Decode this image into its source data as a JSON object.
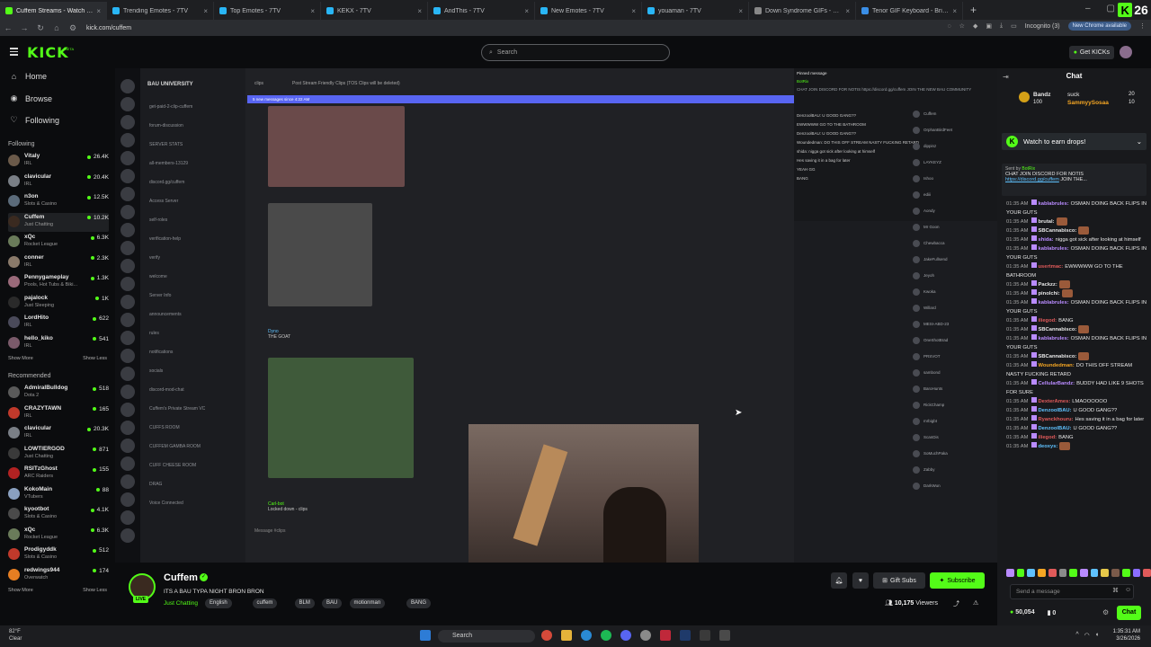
{
  "browser": {
    "tabs": [
      {
        "title": "Cuffem Streams - Watch Live on",
        "active": true,
        "color": "#53fc18"
      },
      {
        "title": "Trending Emotes - 7TV",
        "active": false,
        "color": "#29b6f6"
      },
      {
        "title": "Top Emotes - 7TV",
        "active": false,
        "color": "#29b6f6"
      },
      {
        "title": "KEKX - 7TV",
        "active": false,
        "color": "#29b6f6"
      },
      {
        "title": "AndThis - 7TV",
        "active": false,
        "color": "#29b6f6"
      },
      {
        "title": "New Emotes - 7TV",
        "active": false,
        "color": "#29b6f6"
      },
      {
        "title": "youaman - 7TV",
        "active": false,
        "color": "#29b6f6"
      },
      {
        "title": "Down Syndrome GIFs - Find &",
        "active": false,
        "color": "#888888"
      },
      {
        "title": "Tenor GIF Keyboard - Bring Pe",
        "active": false,
        "color": "#3a8ee6"
      }
    ],
    "new_tab": "+",
    "url": "kick.com/cuffem",
    "incognito_label": "Incognito (3)",
    "new_chrome_label": "New Chrome available",
    "kick_badge_letter": "K",
    "kick_badge_count": "26"
  },
  "header": {
    "logo": "KICK",
    "logo_beta": "BETA",
    "search_placeholder": "Search",
    "get_kicks_label": "Get KICKs"
  },
  "sidebar": {
    "nav": [
      {
        "label": "Home",
        "icon": "⌂"
      },
      {
        "label": "Browse",
        "icon": "◉"
      },
      {
        "label": "Following",
        "icon": "♡"
      }
    ],
    "following_title": "Following",
    "following": [
      {
        "name": "Vitaly",
        "category": "IRL",
        "viewers": "26.4K",
        "color": "#6b5a4a"
      },
      {
        "name": "clavicular",
        "category": "IRL",
        "viewers": "20.4K",
        "color": "#7a7f86"
      },
      {
        "name": "n3on",
        "category": "Slots & Casino",
        "viewers": "12.5K",
        "color": "#5b6b7a"
      },
      {
        "name": "Cuffem",
        "category": "Just Chatting",
        "viewers": "10.2K",
        "color": "#3a2a20",
        "selected": true
      },
      {
        "name": "xQc",
        "category": "Rocket League",
        "viewers": "6.3K",
        "color": "#6a7b5a"
      },
      {
        "name": "conner",
        "category": "IRL",
        "viewers": "2.3K",
        "color": "#8a7a6a"
      },
      {
        "name": "Pennygameplay",
        "category": "Pools, Hot Tubs & Biki...",
        "viewers": "1.3K",
        "color": "#9a6a7a"
      },
      {
        "name": "pajalock",
        "category": "Just Sleeping",
        "viewers": "1K",
        "color": "#2a2a2a"
      },
      {
        "name": "LordHito",
        "category": "IRL",
        "viewers": "622",
        "color": "#4a4a5a"
      },
      {
        "name": "hello_kiko",
        "category": "IRL",
        "viewers": "541",
        "color": "#7a5a6a"
      }
    ],
    "show_more": "Show More",
    "show_less": "Show Less",
    "recommended_title": "Recommended",
    "recommended": [
      {
        "name": "AdmiralBulldog",
        "category": "Dota 2",
        "viewers": "518",
        "color": "#5a5a5a"
      },
      {
        "name": "CRAZYTAWN",
        "category": "IRL",
        "viewers": "165",
        "color": "#c0392b"
      },
      {
        "name": "clavicular",
        "category": "IRL",
        "viewers": "20.3K",
        "color": "#7a7f86"
      },
      {
        "name": "LOWTIERGOD",
        "category": "Just Chatting",
        "viewers": "871",
        "color": "#3a3a3a"
      },
      {
        "name": "RSITzGhost",
        "category": "ARC Raiders",
        "viewers": "155",
        "color": "#b22222"
      },
      {
        "name": "KokoMain",
        "category": "VTubers",
        "viewers": "88",
        "color": "#8aa0c0"
      },
      {
        "name": "kyootbot",
        "category": "Slots & Casino",
        "viewers": "4.1K",
        "color": "#4a4a4a"
      },
      {
        "name": "xQc",
        "category": "Rocket League",
        "viewers": "6.3K",
        "color": "#6a7b5a"
      },
      {
        "name": "Prodigyddk",
        "category": "Slots & Casino",
        "viewers": "512",
        "color": "#c0392b"
      },
      {
        "name": "redwings944",
        "category": "Overwatch",
        "viewers": "174",
        "color": "#e67e22"
      }
    ]
  },
  "video": {
    "discord_server": "BAU UNIVERSITY",
    "channels": [
      "get-paid-2-clip-cuffem",
      "forum-discussion",
      "SERVER STATS",
      "all-members-13129",
      "discord.gg/cuffem",
      "Access Server",
      "self-roles",
      "verification-help",
      "verify",
      "welcome",
      "Server Info",
      "announcements",
      "rules",
      "notifications",
      "socials",
      "discord-mod-chat",
      "Cuffem's Private Stream VC",
      "CUFFS ROOM",
      "CUFFEM GAMBA ROOM",
      "CUFF CHEESE ROOM",
      "DRAG",
      "Voice Connected"
    ],
    "channel_header": "clips",
    "channel_topic": "Post Stream Friendly Clips (TOS Clips will be deleted)",
    "new_messages": "5 new messages since 4:22 AM",
    "messages": [
      {
        "user": "Dyno",
        "text": "THE GOAT"
      },
      {
        "user": "Carl-bot",
        "text": "Locked down - clips"
      }
    ],
    "message_placeholder": "Message #clips",
    "pinned_title": "Pinned message",
    "pinned_user": "BotRix",
    "pinned_text": "CHAT JOIN DISCORD FOR NOTIS https://discord.gg/cuffem JOIN THE NEW BAU COMMUNITY",
    "overlay_chat": [
      "DenzoolBAU: U GOOD GANG??",
      "EWWWWW GO TO THE BATHROOM",
      "DenzoolBAU: U GOOD GANG??",
      "Woundedman: DO THIS OFF STREAM NASTY FUCKING RETARD",
      "shida: nigga got sick after looking at himself",
      "Hes saving it in a bag for later",
      "YEAH GG",
      "BANG"
    ],
    "members": [
      "Cuffem",
      "OrphanBirdFeet",
      "dippinz",
      "LAYKEYZ",
      "Ishoo",
      "ediii",
      "Aondy",
      "Mr Goon",
      "Chewbacca",
      "JakeFullsend",
      "Jeyoh",
      "Kwoka",
      "Willard",
      "MESI-ABD-23",
      "OneShotBrad",
      "PRSVOT",
      "sambond",
      "BaroHunts",
      "RickChamp",
      "mrbigbt",
      "ScanDis",
      "SoMuchPaka",
      "Zabby",
      "DarkWun"
    ]
  },
  "stream": {
    "streamer": "Cuffem",
    "live_label": "LIVE",
    "title": "ITS A BAU TYPA NIGHT BRON BRON",
    "category": "Just Chatting",
    "tags": [
      "English",
      "cuffem",
      "BLM",
      "BAU",
      "motionman",
      "BANG"
    ],
    "gift_subs_label": "Gift Subs",
    "subscribe_label": "Subscribe",
    "viewers": "10,175",
    "viewers_label": "Viewers"
  },
  "chat": {
    "title": "Chat",
    "leaderboard": [
      {
        "name": "Bandz",
        "amount": "100",
        "value": "suck",
        "count": "20"
      },
      {
        "name": "SammyySosaa",
        "count": "10"
      }
    ],
    "watch_label": "Watch to earn drops!",
    "pinned_sent_by": "Sent by",
    "pinned_sender": "BotRix",
    "pinned_text": "CHAT JOIN DISCORD FOR NOTIS",
    "pinned_link": "https://discord.gg/cuffem",
    "pinned_more": "JOIN THE...",
    "messages": [
      {
        "time": "01:35 AM",
        "user": "kablabrules:",
        "color": "#b98bff",
        "text": "OSMAN DOING BACK FLIPS IN YOUR GUTS"
      },
      {
        "time": "01:35 AM",
        "user": "brutal:",
        "color": "#e6e6e6",
        "text": ""
      },
      {
        "time": "01:35 AM",
        "user": "SBCannabisco:",
        "color": "#e6e6e6",
        "text": ""
      },
      {
        "time": "01:35 AM",
        "user": "shida:",
        "color": "#b98bff",
        "text": "nigga got sick after looking at himself"
      },
      {
        "time": "01:35 AM",
        "user": "kablabrules:",
        "color": "#b98bff",
        "text": "OSMAN DOING BACK FLIPS IN YOUR GUTS"
      },
      {
        "time": "01:35 AM",
        "user": "usertmac:",
        "color": "#e05a5a",
        "text": "EWWWWW GO TO THE BATHROOM"
      },
      {
        "time": "01:35 AM",
        "user": "Packzz:",
        "color": "#e6e6e6",
        "text": ""
      },
      {
        "time": "01:35 AM",
        "user": "pinolchi:",
        "color": "#e6e6e6",
        "text": ""
      },
      {
        "time": "01:35 AM",
        "user": "kablabrules:",
        "color": "#b98bff",
        "text": "OSMAN DOING BACK FLIPS IN YOUR GUTS"
      },
      {
        "time": "01:35 AM",
        "user": "iliegod:",
        "color": "#e05a5a",
        "text": "BANG"
      },
      {
        "time": "01:35 AM",
        "user": "SBCannabisco:",
        "color": "#e6e6e6",
        "text": ""
      },
      {
        "time": "01:35 AM",
        "user": "kablabrules:",
        "color": "#b98bff",
        "text": "OSMAN DOING BACK FLIPS IN YOUR GUTS"
      },
      {
        "time": "01:35 AM",
        "user": "SBCannabisco:",
        "color": "#e6e6e6",
        "text": ""
      },
      {
        "time": "01:35 AM",
        "user": "Woundedman:",
        "color": "#f5a623",
        "text": "DO THIS OFF STREAM NASTY FUCKING RETARD"
      },
      {
        "time": "01:35 AM",
        "user": "CellularBandz:",
        "color": "#b98bff",
        "text": "BUDDY HAD LIKE 9 SHOTS FOR SURE"
      },
      {
        "time": "01:35 AM",
        "user": "DexterAmes:",
        "color": "#e05a5a",
        "text": "LMAOOOOOO"
      },
      {
        "time": "01:35 AM",
        "user": "DenzoolBAU:",
        "color": "#5fc2ff",
        "text": "U GOOD GANG??"
      },
      {
        "time": "01:35 AM",
        "user": "Ryanckhouru:",
        "color": "#e05a5a",
        "text": "Hes saving it in a bag for later"
      },
      {
        "time": "01:35 AM",
        "user": "DenzoolBAU:",
        "color": "#5fc2ff",
        "text": "U GOOD GANG??"
      },
      {
        "time": "01:35 AM",
        "user": "iliegod:",
        "color": "#e05a5a",
        "text": "BANG"
      },
      {
        "time": "01:35 AM",
        "user": "deoxys:",
        "color": "#5fc2ff",
        "text": ""
      }
    ],
    "send_placeholder": "Send a message",
    "kicks_balance": "50,054",
    "second_balance": "0",
    "chat_button": "Chat"
  },
  "taskbar": {
    "temperature": "82°F",
    "weather": "Clear",
    "search_label": "Search",
    "time": "1:35:31 AM",
    "date": "3/26/2026"
  },
  "colors": {
    "kick_green": "#53fc18",
    "discord_blurple": "#5865f2",
    "background": "#0b0c0e"
  }
}
